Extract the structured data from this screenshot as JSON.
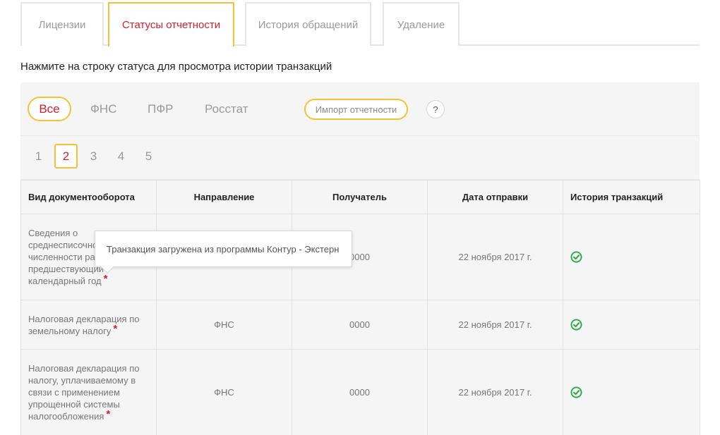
{
  "tabs": [
    {
      "label": "Лицензии",
      "active": false
    },
    {
      "label": "Статусы отчетности",
      "active": true
    },
    {
      "label": "История обращений",
      "active": false
    },
    {
      "label": "Удаление",
      "active": false
    }
  ],
  "hint": "Нажмите на строку статуса для просмотра истории транзакций",
  "filters": [
    {
      "label": "Все",
      "active": true
    },
    {
      "label": "ФНС",
      "active": false
    },
    {
      "label": "ПФР",
      "active": false
    },
    {
      "label": "Росстат",
      "active": false
    }
  ],
  "import_button": "Импорт отчетности",
  "help_button": "?",
  "pages": [
    "1",
    "2",
    "3",
    "4",
    "5"
  ],
  "current_page": "2",
  "table": {
    "headers": [
      "Вид документооборота",
      "Направление",
      "Получатель",
      "Дата отправки",
      "История транзакций"
    ],
    "rows": [
      {
        "doc": "Сведения о среднесписочной численности работников за предшествующий календарный год",
        "direction": "",
        "recipient": "0000",
        "date": "22 ноября 2017 г.",
        "status_icon": "check-circle-icon"
      },
      {
        "doc": "Налоговая декларация по земельному налогу",
        "direction": "ФНС",
        "recipient": "0000",
        "date": "22 ноября 2017 г.",
        "status_icon": "check-circle-icon"
      },
      {
        "doc": "Налоговая декларация по налогу, уплачиваемому в связи с применением упрощенной системы налогообложения",
        "direction": "ФНС",
        "recipient": "0000",
        "date": "22 ноября 2017 г.",
        "status_icon": "check-circle-icon"
      }
    ],
    "required_mark": "*"
  },
  "tooltip": "Транзакция загружена из программы Контур - Экстерн",
  "colors": {
    "accent_border": "#f2c33a",
    "active_text": "#d0212e",
    "ok_green": "#2aa84a",
    "panel_bg": "#f5f5f5"
  }
}
